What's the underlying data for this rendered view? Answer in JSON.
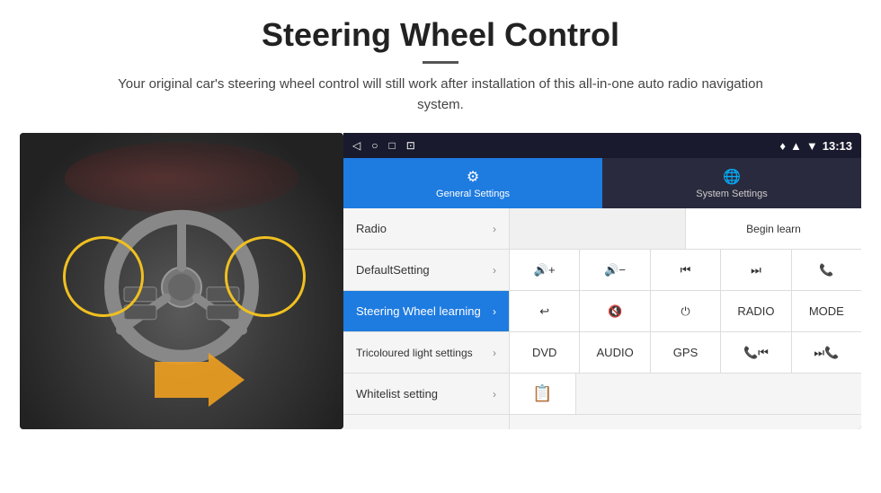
{
  "header": {
    "title": "Steering Wheel Control",
    "subtitle": "Your original car's steering wheel control will still work after installation of this all-in-one auto radio navigation system."
  },
  "status_bar": {
    "nav_back": "◁",
    "nav_home": "○",
    "nav_recent": "□",
    "nav_screen": "⊡",
    "signal_icon": "▲",
    "wifi_icon": "▼",
    "time": "13:13"
  },
  "tabs": [
    {
      "id": "general",
      "label": "General Settings",
      "active": true
    },
    {
      "id": "system",
      "label": "System Settings",
      "active": false
    }
  ],
  "menu_items": [
    {
      "id": "radio",
      "label": "Radio"
    },
    {
      "id": "default",
      "label": "DefaultSetting"
    },
    {
      "id": "steering",
      "label": "Steering Wheel learning",
      "active": true
    },
    {
      "id": "tricoloured",
      "label": "Tricoloured light settings"
    },
    {
      "id": "whitelist",
      "label": "Whitelist setting"
    }
  ],
  "controls": {
    "begin_learn_label": "Begin learn",
    "row2": [
      {
        "icon": "🔊+",
        "type": "icon"
      },
      {
        "icon": "🔊−",
        "type": "icon"
      },
      {
        "icon": "⏮",
        "type": "icon"
      },
      {
        "icon": "⏭",
        "type": "icon"
      },
      {
        "icon": "📞",
        "type": "icon"
      }
    ],
    "row3": [
      {
        "icon": "↩",
        "type": "icon"
      },
      {
        "icon": "🔊✕",
        "type": "icon"
      },
      {
        "icon": "⏻",
        "type": "icon"
      },
      {
        "label": "RADIO",
        "type": "text"
      },
      {
        "label": "MODE",
        "type": "text"
      }
    ],
    "row4": [
      {
        "label": "DVD",
        "type": "text"
      },
      {
        "label": "AUDIO",
        "type": "text"
      },
      {
        "label": "GPS",
        "type": "text"
      },
      {
        "icon": "📞⏮",
        "type": "icon"
      },
      {
        "icon": "⏮📞",
        "type": "icon"
      }
    ],
    "row5": [
      {
        "icon": "📋",
        "type": "icon"
      }
    ]
  }
}
